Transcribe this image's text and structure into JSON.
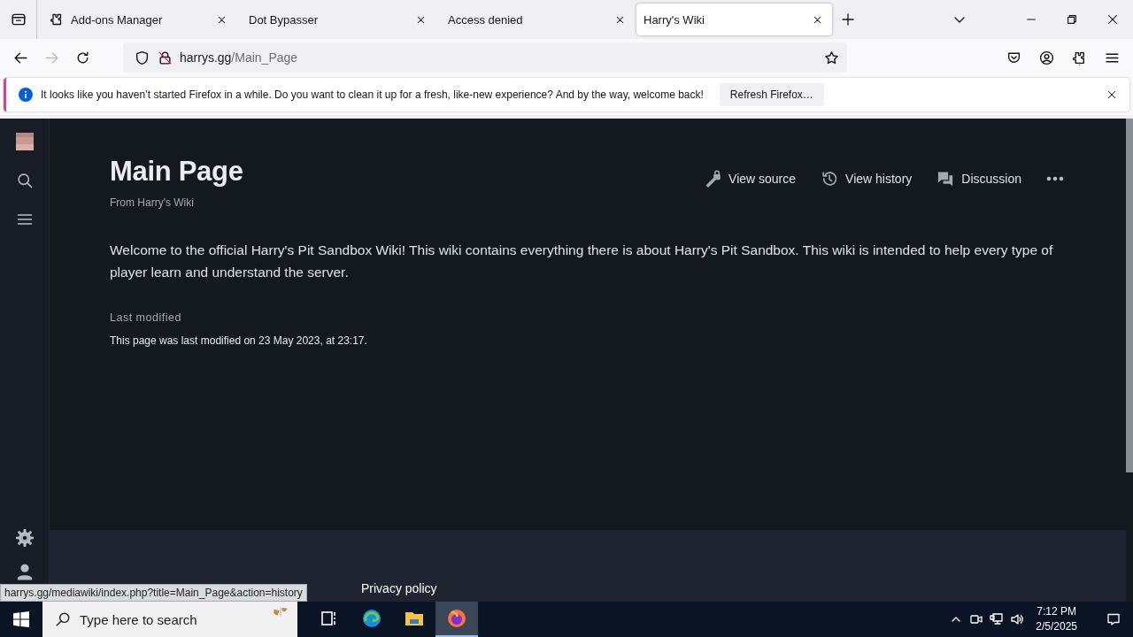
{
  "tabs": [
    {
      "label": "Add-ons Manager",
      "selected": false,
      "has_icon": true
    },
    {
      "label": "Dot Bypasser",
      "selected": false,
      "has_icon": false
    },
    {
      "label": "Access denied",
      "selected": false,
      "has_icon": false
    },
    {
      "label": "Harry's Wiki",
      "selected": true,
      "has_icon": false
    }
  ],
  "address": {
    "host": "harrys.gg",
    "path": "/Main_Page"
  },
  "notice": {
    "message": "It looks like you haven’t started Firefox in a while. Do you want to clean it up for a fresh, like-new experience? And by the way, welcome back!",
    "button": "Refresh Firefox…"
  },
  "wiki": {
    "title": "Main Page",
    "subtitle": "From Harry's Wiki",
    "actions": [
      {
        "label": "View source",
        "kind": "source"
      },
      {
        "label": "View history",
        "kind": "history"
      },
      {
        "label": "Discussion",
        "kind": "discussion"
      }
    ],
    "intro": "Welcome to the official Harry's Pit Sandbox Wiki! This wiki contains everything there is about Harry's Pit Sandbox. This wiki is intended to help every type of player learn and understand the server.",
    "last_modified_heading": "Last modified",
    "last_modified": "This page was last modified on 23 May 2023, at 23:17.",
    "footer_link": "Privacy policy"
  },
  "status_url": "harrys.gg/mediawiki/index.php?title=Main_Page&action=history",
  "taskbar": {
    "search_placeholder": "Type here to search",
    "time": "7:12 PM",
    "date": "2/5/2025",
    "apps": [
      {
        "kind": "taskview",
        "selected": false
      },
      {
        "kind": "edge",
        "selected": false
      },
      {
        "kind": "explorer",
        "selected": false
      },
      {
        "kind": "firefox",
        "selected": true
      }
    ]
  }
}
